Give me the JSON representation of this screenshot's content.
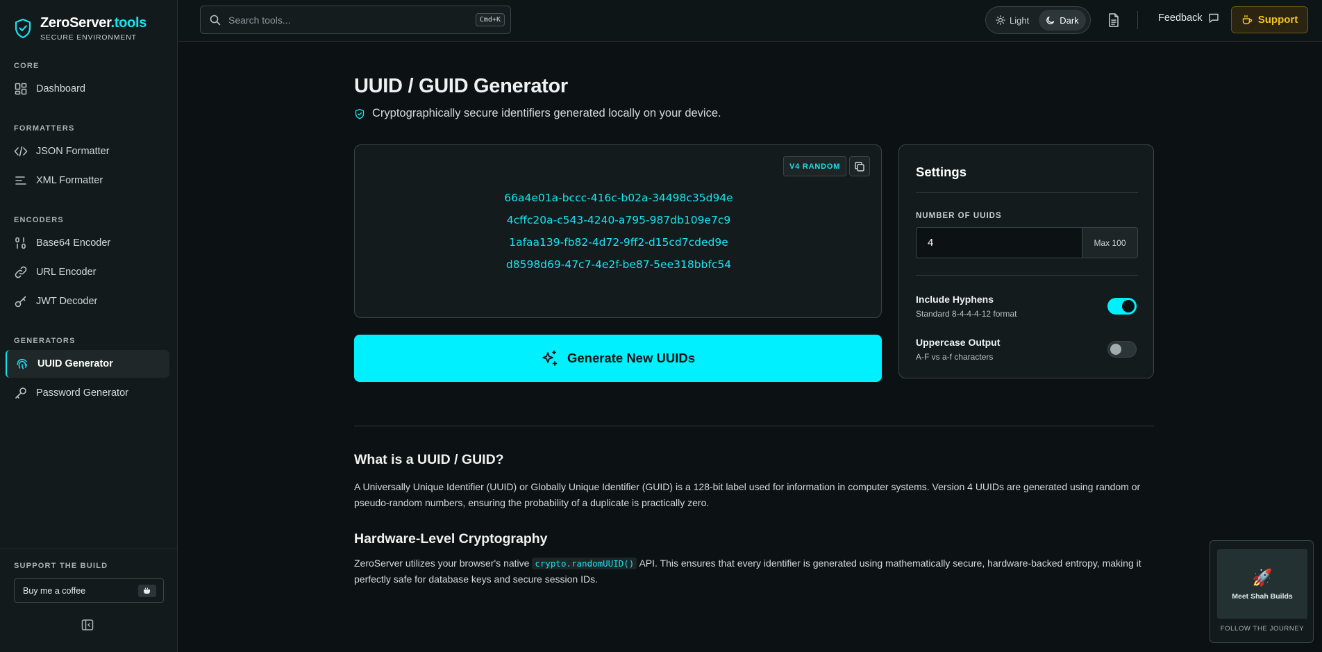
{
  "brand": {
    "name_main": "ZeroServer",
    "name_tld": ".tools",
    "subtitle": "SECURE ENVIRONMENT"
  },
  "sidebar": {
    "sections": [
      {
        "title": "CORE",
        "items": [
          {
            "label": "Dashboard",
            "icon": "dashboard-icon"
          }
        ]
      },
      {
        "title": "FORMATTERS",
        "items": [
          {
            "label": "JSON Formatter",
            "icon": "code-icon"
          },
          {
            "label": "XML Formatter",
            "icon": "lines-icon"
          }
        ]
      },
      {
        "title": "ENCODERS",
        "items": [
          {
            "label": "Base64 Encoder",
            "icon": "binary-icon"
          },
          {
            "label": "URL Encoder",
            "icon": "link-icon"
          },
          {
            "label": "JWT Decoder",
            "icon": "key-icon"
          }
        ]
      },
      {
        "title": "GENERATORS",
        "items": [
          {
            "label": "UUID Generator",
            "icon": "fingerprint-icon",
            "active": true
          },
          {
            "label": "Password Generator",
            "icon": "key-icon"
          }
        ]
      }
    ],
    "support_title": "SUPPORT THE BUILD",
    "coffee_label": "Buy me a coffee",
    "coffee_icon": "coffee-cup-icon"
  },
  "topbar": {
    "search_placeholder": "Search tools...",
    "search_shortcut": "Cmd+K",
    "theme_light": "Light",
    "theme_dark": "Dark",
    "feedback_label": "Feedback",
    "support_label": "Support"
  },
  "main": {
    "title": "UUID / GUID Generator",
    "subtitle": "Cryptographically secure identifiers generated locally on your device.",
    "badge": "V4 RANDOM",
    "uuids": [
      "66a4e01a-bccc-416c-b02a-34498c35d94e",
      "4cffc20a-c543-4240-a795-987db109e7c9",
      "1afaa139-fb82-4d72-9ff2-d15cd7cded9e",
      "d8598d69-47c7-4e2f-be87-5ee318bbfc54"
    ],
    "generate_label": "Generate New UUIDs"
  },
  "settings": {
    "title": "Settings",
    "count_label": "NUMBER OF UUIDS",
    "count_value": "4",
    "max_label": "Max 100",
    "hyphens_title": "Include Hyphens",
    "hyphens_desc": "Standard 8-4-4-4-12 format",
    "hyphens_on": true,
    "upper_title": "Uppercase Output",
    "upper_desc": "A-F vs a-f characters",
    "upper_on": false
  },
  "info": {
    "h1": "What is a UUID / GUID?",
    "p1": "A Universally Unique Identifier (UUID) or Globally Unique Identifier (GUID) is a 128-bit label used for information in computer systems. Version 4 UUIDs are generated using random or pseudo-random numbers, ensuring the probability of a duplicate is practically zero.",
    "h2": "Hardware-Level Cryptography",
    "p2_before": "ZeroServer utilizes your browser's native ",
    "p2_code": "crypto.randomUUID()",
    "p2_after": " API. This ensures that every identifier is generated using mathematically secure, hardware-backed entropy, making it perfectly safe for database keys and secure session IDs."
  },
  "promo": {
    "name": "Meet Shah Builds",
    "follow": "FOLLOW THE JOURNEY",
    "icon": "rocket-icon"
  },
  "colors": {
    "accent": "#00f0ff",
    "support": "#f5c518",
    "background": "#0c1213"
  }
}
